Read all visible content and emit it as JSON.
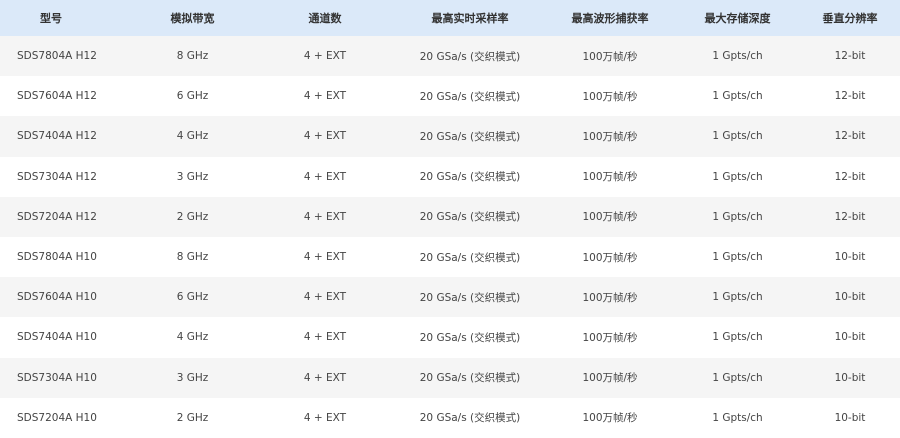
{
  "table": {
    "headers": [
      "型号",
      "模拟带宽",
      "通道数",
      "最高实时采样率",
      "最高波形捕获率",
      "最大存储深度",
      "垂直分辨率"
    ],
    "rows": [
      [
        "SDS7804A H12",
        "8 GHz",
        "4 + EXT",
        "20 GSa/s (交织模式)",
        "100万帧/秒",
        "1 Gpts/ch",
        "12-bit"
      ],
      [
        "SDS7604A H12",
        "6 GHz",
        "4 + EXT",
        "20 GSa/s (交织模式)",
        "100万帧/秒",
        "1 Gpts/ch",
        "12-bit"
      ],
      [
        "SDS7404A H12",
        "4 GHz",
        "4 + EXT",
        "20 GSa/s (交织模式)",
        "100万帧/秒",
        "1 Gpts/ch",
        "12-bit"
      ],
      [
        "SDS7304A H12",
        "3 GHz",
        "4 + EXT",
        "20 GSa/s (交织模式)",
        "100万帧/秒",
        "1 Gpts/ch",
        "12-bit"
      ],
      [
        "SDS7204A H12",
        "2 GHz",
        "4 + EXT",
        "20 GSa/s (交织模式)",
        "100万帧/秒",
        "1 Gpts/ch",
        "12-bit"
      ],
      [
        "SDS7804A H10",
        "8 GHz",
        "4 + EXT",
        "20 GSa/s (交织模式)",
        "100万帧/秒",
        "1 Gpts/ch",
        "10-bit"
      ],
      [
        "SDS7604A H10",
        "6 GHz",
        "4 + EXT",
        "20 GSa/s (交织模式)",
        "100万帧/秒",
        "1 Gpts/ch",
        "10-bit"
      ],
      [
        "SDS7404A H10",
        "4 GHz",
        "4 + EXT",
        "20 GSa/s (交织模式)",
        "100万帧/秒",
        "1 Gpts/ch",
        "10-bit"
      ],
      [
        "SDS7304A H10",
        "3 GHz",
        "4 + EXT",
        "20 GSa/s (交织模式)",
        "100万帧/秒",
        "1 Gpts/ch",
        "10-bit"
      ],
      [
        "SDS7204A H10",
        "2 GHz",
        "4 + EXT",
        "20 GSa/s (交织模式)",
        "100万帧/秒",
        "1 Gpts/ch",
        "10-bit"
      ]
    ]
  },
  "colors": {
    "header_bg": "#dbe9f9",
    "row_alt_bg": "#f5f5f5",
    "row_bg": "#ffffff"
  }
}
